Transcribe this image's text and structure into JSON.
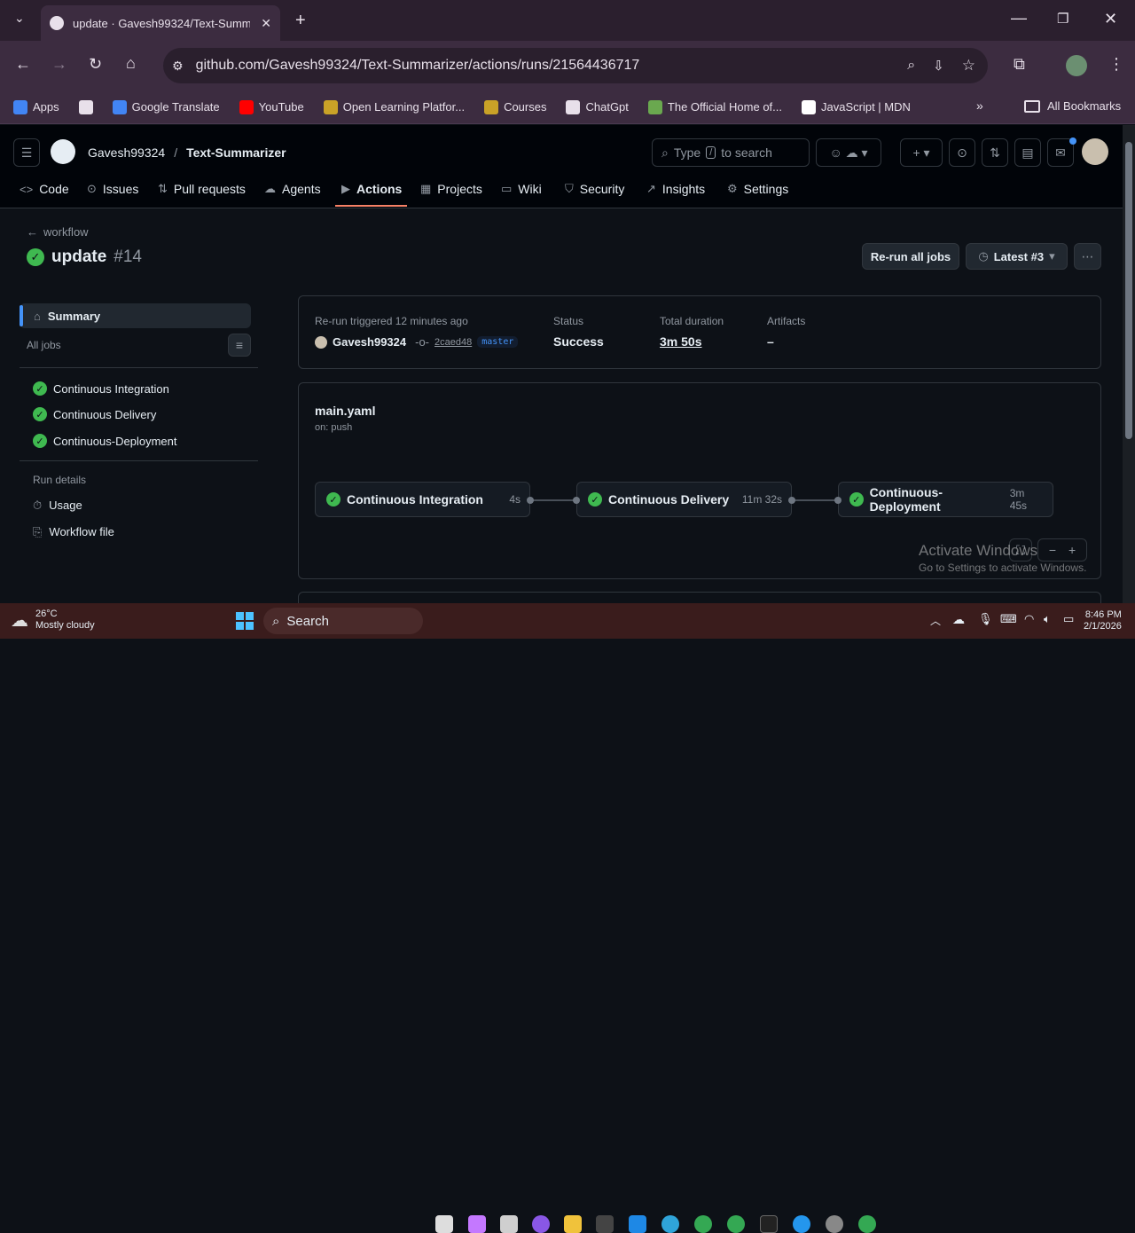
{
  "browser": {
    "tab_title": "update · Gavesh99324/Text-Summ",
    "url": "github.com/Gavesh99324/Text-Summarizer/actions/runs/21564436717",
    "bookmarks": [
      {
        "label": "Apps",
        "icon": "apps-grid-icon",
        "color": "#4285f4"
      },
      {
        "label": "",
        "icon": "grid-icon",
        "color": "#e8e0ea"
      },
      {
        "label": "Google Translate",
        "icon": "translate-icon",
        "color": "#4285f4"
      },
      {
        "label": "YouTube",
        "icon": "youtube-icon",
        "color": "#ff0000"
      },
      {
        "label": "Open Learning Platfor...",
        "icon": "seal-icon",
        "color": "#c9a227"
      },
      {
        "label": "Courses",
        "icon": "seal-icon",
        "color": "#c9a227"
      },
      {
        "label": "ChatGpt",
        "icon": "openai-icon",
        "color": "#e8e0ea"
      },
      {
        "label": "The Official Home of...",
        "icon": "leaf-icon",
        "color": "#6aa84f"
      },
      {
        "label": "JavaScript | MDN",
        "icon": "mdn-icon",
        "color": "#ffffff"
      }
    ],
    "all_bookmarks": "All Bookmarks"
  },
  "github": {
    "owner": "Gavesh99324",
    "repo": "Text-Summarizer",
    "search_placeholder": "Type / to search",
    "search_prefix": "Type",
    "search_key": "/",
    "search_suffix": "to search",
    "nav": [
      "Code",
      "Issues",
      "Pull requests",
      "Agents",
      "Actions",
      "Projects",
      "Wiki",
      "Security",
      "Insights",
      "Settings"
    ],
    "active_nav": "Actions"
  },
  "run": {
    "back_label": "workflow",
    "title": "update",
    "number": "#14",
    "rerun_button": "Re-run all jobs",
    "attempt_button": "Latest #3",
    "trigger_text": "Re-run triggered 12 minutes ago",
    "actor": "Gavesh99324",
    "commit": "2caed48",
    "branch": "master",
    "status_label": "Status",
    "status_value": "Success",
    "duration_label": "Total duration",
    "duration_value": "3m 50s",
    "artifacts_label": "Artifacts",
    "artifacts_value": "–"
  },
  "sidebar": {
    "summary": "Summary",
    "all_jobs": "All jobs",
    "jobs": [
      "Continuous Integration",
      "Continuous Delivery",
      "Continuous-Deployment"
    ],
    "run_details": "Run details",
    "usage": "Usage",
    "workflow_file": "Workflow file"
  },
  "workflow": {
    "file": "main.yaml",
    "trigger": "on: push",
    "jobs": [
      {
        "name": "Continuous Integration",
        "duration": "4s"
      },
      {
        "name": "Continuous Delivery",
        "duration": "11m 32s"
      },
      {
        "name": "Continuous-Deployment",
        "duration": "3m 45s"
      }
    ]
  },
  "watermark": {
    "line1": "Activate Windows",
    "line2": "Go to Settings to activate Windows."
  },
  "taskbar": {
    "weather_temp": "26°C",
    "weather_desc": "Mostly cloudy",
    "search": "Search",
    "time": "8:46 PM",
    "date": "2/1/2026"
  },
  "colors": {
    "success": "#3fb950",
    "accent_underline": "#f78166",
    "link": "#4493f8"
  }
}
